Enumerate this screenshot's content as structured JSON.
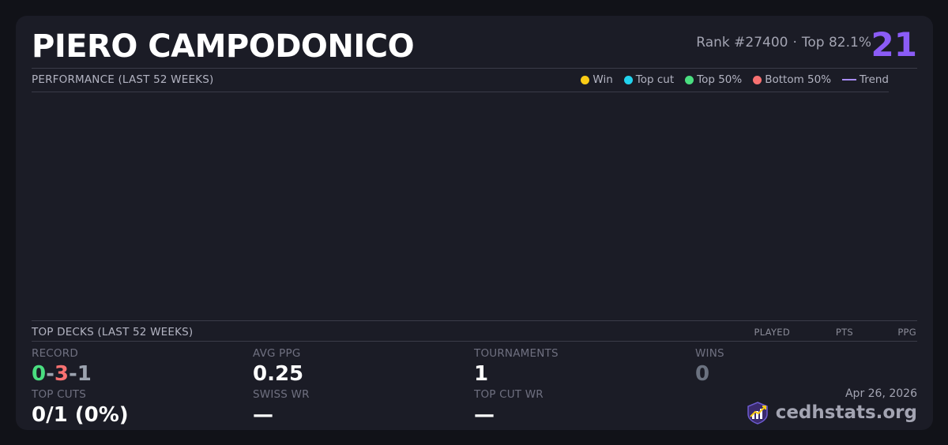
{
  "player": {
    "name": "PIERO CAMPODONICO",
    "rank_label": "Rank #27400",
    "separator": "·",
    "top_percent": "Top 82.1%",
    "score": "21"
  },
  "performance": {
    "title": "PERFORMANCE (LAST 52 WEEKS)",
    "legend": [
      {
        "label": "Win",
        "color": "#facc15",
        "shape": "dot"
      },
      {
        "label": "Top cut",
        "color": "#22d3ee",
        "shape": "dot"
      },
      {
        "label": "Top 50%",
        "color": "#4ade80",
        "shape": "dot"
      },
      {
        "label": "Bottom 50%",
        "color": "#f87171",
        "shape": "dot"
      },
      {
        "label": "Trend",
        "color": "#a78bfa",
        "shape": "line"
      }
    ]
  },
  "top_decks": {
    "title": "TOP DECKS (LAST 52 WEEKS)",
    "columns": [
      "PLAYED",
      "PTS",
      "PPG"
    ]
  },
  "stats": {
    "record": {
      "label": "RECORD",
      "wins": "0",
      "losses": "3",
      "draws": "1",
      "sep": "-"
    },
    "avg_ppg": {
      "label": "AVG PPG",
      "value": "0.25"
    },
    "tournaments": {
      "label": "TOURNAMENTS",
      "value": "1"
    },
    "wins": {
      "label": "WINS",
      "value": "0"
    },
    "top_cuts": {
      "label": "TOP CUTS",
      "value": "0/1 (0%)"
    },
    "swiss_wr": {
      "label": "SWISS WR",
      "value": "—"
    },
    "top_cut_wr": {
      "label": "TOP CUT WR",
      "value": "—"
    }
  },
  "footer": {
    "date": "Apr 26, 2026",
    "brand": "cedhstats.org",
    "logo_icon": "chart-shield-logo-icon"
  },
  "colors": {
    "accent": "#8b5cf6",
    "win_green": "#4ade80",
    "loss_red": "#f87171",
    "draw_gray": "#9ca3af"
  }
}
